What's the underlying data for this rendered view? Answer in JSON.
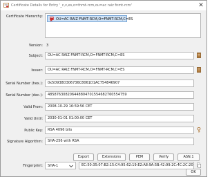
{
  "window": {
    "title": "Certificate Details for Entry '_c,v,es,o=fnmt-rcm,ou=ac raiz fnmt-rcm'",
    "close_glyph": "✕"
  },
  "hierarchy": {
    "label": "Certificate Hierarchy:",
    "items": [
      "OU=AC RAIZ FNMT-RCM,O=FNMT-RCM,C=ES"
    ]
  },
  "fields": {
    "version": {
      "label": "Version:",
      "value": "3"
    },
    "subject": {
      "label": "Subject:",
      "value": "OU=AC RAIZ FNMT-RCM,O=FNMT-RCM,C=ES"
    },
    "issuer": {
      "label": "Issuer:",
      "value": "OU=AC RAIZ FNMT-RCM,O=FNMT-RCM,C=ES"
    },
    "serial_hex": {
      "label": "Serial Number (hex.):",
      "value": "0x5D938D306736C8061D1AC754846907"
    },
    "serial_dec": {
      "label": "Serial Number (dec.):",
      "value": "485876308206448804701554682760554759"
    },
    "valid_from": {
      "label": "Valid From:",
      "value": "2008-10-29 16:59:56 CET"
    },
    "valid_until": {
      "label": "Valid Until:",
      "value": "2030-01-01 01:00:00 CET"
    },
    "public_key": {
      "label": "Public Key:",
      "value": "RSA 4096 bits"
    },
    "signature_algorithm": {
      "label": "Signature Algorithm:",
      "value": "SHA-256 with RSA"
    },
    "fingerprint": {
      "label": "Fingerprint:",
      "algorithm": "SHA-1",
      "value": "EC:50:35:07:B2:15:C4:95:62:19:E2:A8:9A:5B:42:99:2C:4C:2C:20"
    }
  },
  "buttons": {
    "export": "Export",
    "extensions": "Extensions",
    "pem": "PEM",
    "verify": "Verify",
    "asn1": "ASN.1",
    "ok": "OK"
  },
  "colors": {
    "window_bg": "#f0f0f0",
    "selection_bg": "#cfe2f6",
    "cert_icon_red": "#c8292b",
    "details_icon_brown": "#b07a3c"
  }
}
